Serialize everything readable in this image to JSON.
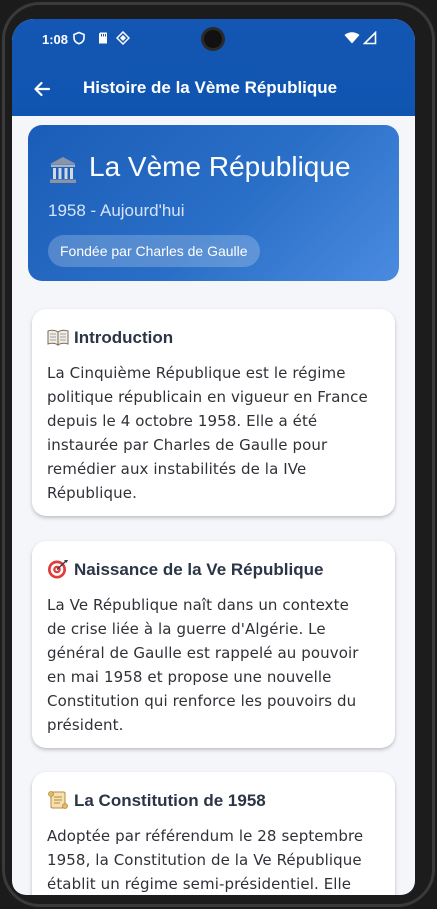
{
  "status_bar": {
    "time": "1:08"
  },
  "app_bar": {
    "title": "Histoire de la Vème République",
    "back_icon": "arrow-left-icon"
  },
  "hero": {
    "icon": "classical-building-icon",
    "title": "La Vème République",
    "subtitle": "1958 - Aujourd'hui",
    "badge": "Fondée par Charles de Gaulle"
  },
  "sections": [
    {
      "icon": "open-book-icon",
      "title": "Introduction",
      "lines": [
        "La Cinquième République est le régime",
        "politique républicain en vigueur en France",
        "depuis le 4 octobre 1958. Elle a été",
        "instaurée par Charles de Gaulle pour",
        "remédier aux instabilités de la IVe",
        "République."
      ]
    },
    {
      "icon": "direct-hit-icon",
      "title": "Naissance de la Ve République",
      "lines": [
        "La Ve République naît dans un contexte",
        "de crise liée à la guerre d'Algérie. Le",
        "général de Gaulle est rappelé au pouvoir",
        "en mai 1958 et propose une nouvelle",
        "Constitution qui renforce les pouvoirs du",
        "président."
      ]
    },
    {
      "icon": "scroll-icon",
      "title": "La Constitution de 1958",
      "lines": [
        "Adoptée par référendum le 28 septembre",
        "1958, la Constitution de la Ve République",
        "établit un régime semi-présidentiel. Elle"
      ]
    }
  ],
  "colors": {
    "app_bar": "#0f55b0",
    "hero_start": "#1a5db8",
    "hero_end": "#4a8be0",
    "background": "#f4f6fa",
    "card": "#ffffff",
    "title_text": "#2b3547"
  }
}
